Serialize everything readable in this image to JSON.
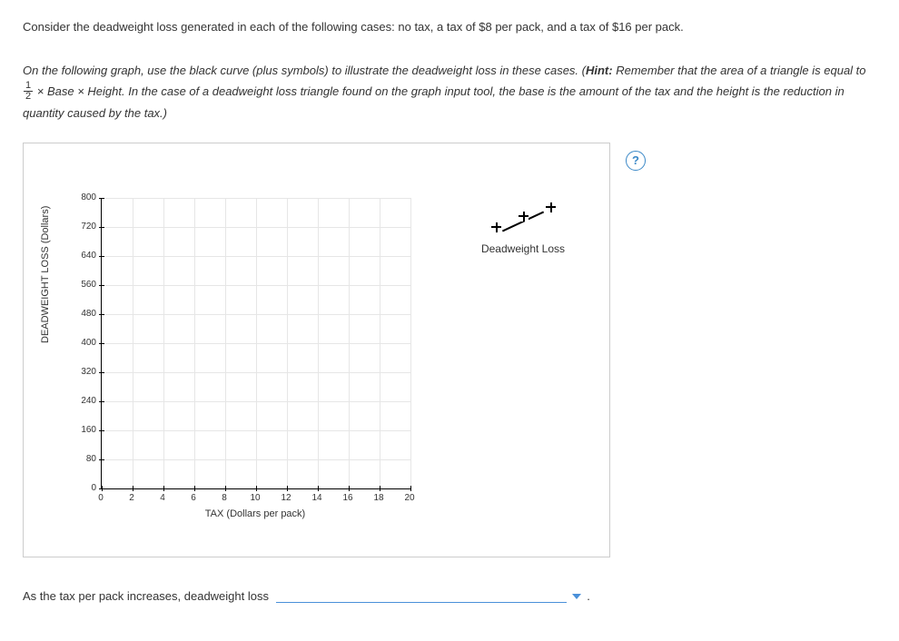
{
  "intro_text": "Consider the deadweight loss generated in each of the following cases: no tax, a tax of $8 per pack, and a tax of $16 per pack.",
  "instructions": {
    "part1": "On the following graph, use the black curve (plus symbols) to illustrate the deadweight loss in these cases. (",
    "hint_label": "Hint:",
    "part2": " Remember that the area of a triangle is equal to ",
    "frac_num": "1",
    "frac_den": "2",
    "times": " × ",
    "base": "Base",
    "times2": " × ",
    "height": "Height",
    "part3": ". In the case of a deadweight loss triangle found on the graph input tool, the base is the amount of the tax and the height is the reduction in quantity caused by the tax.)"
  },
  "help_symbol": "?",
  "legend_label": "Deadweight Loss",
  "chart_data": {
    "type": "scatter",
    "title": "",
    "xlabel": "TAX (Dollars per pack)",
    "ylabel": "DEADWEIGHT LOSS (Dollars)",
    "xlim": [
      0,
      20
    ],
    "ylim": [
      0,
      800
    ],
    "xticks": [
      0,
      2,
      4,
      6,
      8,
      10,
      12,
      14,
      16,
      18,
      20
    ],
    "yticks": [
      0,
      80,
      160,
      240,
      320,
      400,
      480,
      560,
      640,
      720,
      800
    ],
    "series": [
      {
        "name": "Deadweight Loss",
        "color": "#000000",
        "symbol": "plus",
        "values": []
      }
    ]
  },
  "conclusion": {
    "prefix": "As the tax per pack increases, deadweight loss ",
    "suffix": " ."
  }
}
